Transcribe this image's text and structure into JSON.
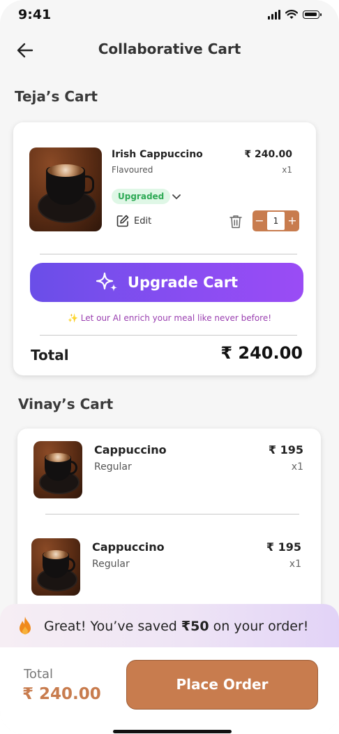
{
  "status_bar": {
    "time": "9:41"
  },
  "header": {
    "title": "Collaborative Cart",
    "back_icon": "arrow-left-icon"
  },
  "carts": [
    {
      "owner_title": "Teja’s Cart",
      "items": [
        {
          "name": "Irish Cappuccino",
          "variant": "Flavoured",
          "price": "₹ 240.00",
          "qty": "x1",
          "badge": "Upgraded",
          "edit_label": "Edit",
          "stepper_value": "1",
          "stepper_minus": "−",
          "stepper_plus": "+"
        }
      ],
      "upgrade_button": "Upgrade Cart",
      "ai_note": "Let our AI enrich your meal like never before!",
      "ai_note_icon": "✨",
      "total_label": "Total",
      "total_value": "₹ 240.00"
    },
    {
      "owner_title": "Vinay’s Cart",
      "items": [
        {
          "name": "Cappuccino",
          "variant": "Regular",
          "price": "₹ 195",
          "qty": "x1"
        },
        {
          "name": "Cappuccino",
          "variant": "Regular",
          "price": "₹ 195",
          "qty": "x1"
        }
      ]
    }
  ],
  "promo": {
    "prefix": "Great! You’ve saved ",
    "amount": "₹50",
    "suffix": " on your order!"
  },
  "footer": {
    "total_label": "Total",
    "total_value": "₹ 240.00",
    "place_order": "Place Order"
  },
  "colors": {
    "accent": "#c87c4e",
    "upgrade_start": "#6a4ee8",
    "upgrade_end": "#9a4cf5",
    "badge_green": "#2eaa55"
  }
}
